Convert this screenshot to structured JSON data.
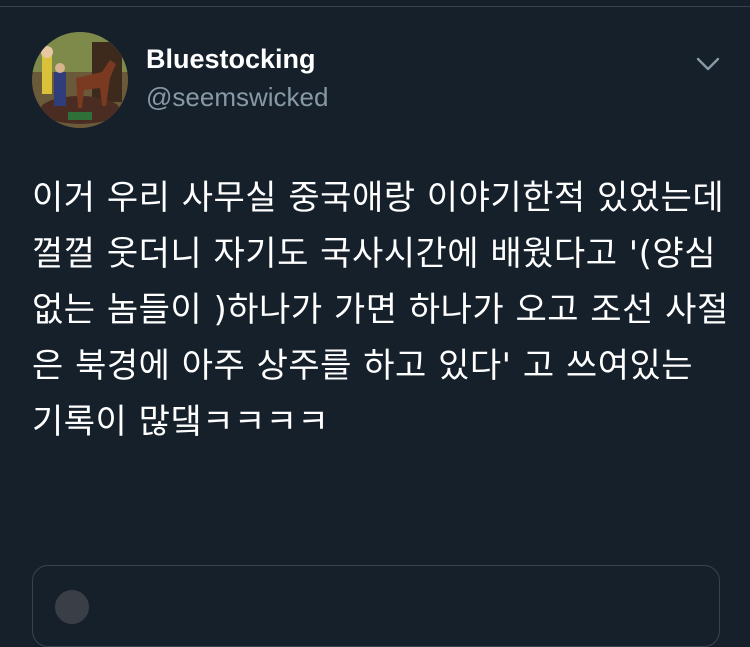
{
  "user": {
    "display_name": "Bluestocking",
    "handle": "@seemswicked"
  },
  "tweet": {
    "text": "이거 우리 사무실 중국애랑 이야기한적 있었는데 껄껄 웃더니 자기도 국사시간에 배웠다고 '(양심없는 놈들이 )하나가 가면 하나가 오고 조선 사절은 북경에 아주 상주를 하고 있다' 고 쓰여있는 기록이 많댘ㅋㅋㅋㅋ"
  },
  "quote": {
    "name": "",
    "meta": ""
  },
  "icons": {
    "menu": "chevron-down-icon",
    "avatar": "avatar-image"
  },
  "colors": {
    "background": "#15202b",
    "secondary_text": "#8899a6",
    "border": "#38444d"
  }
}
